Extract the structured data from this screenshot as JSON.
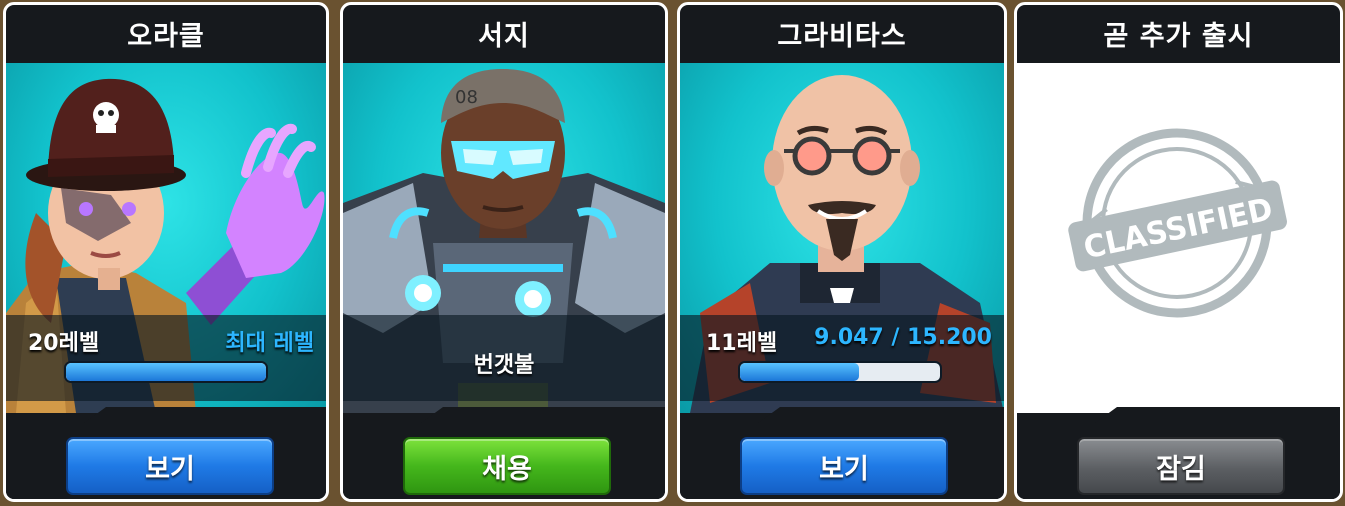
{
  "cards": [
    {
      "title": "오라클",
      "level_label": "20레벨",
      "level_status": "최대 레벨",
      "xp_fraction": 1.0,
      "button_label": "보기",
      "button_style": "blue"
    },
    {
      "title": "서지",
      "center_label": "번갯불",
      "button_label": "채용",
      "button_style": "green"
    },
    {
      "title": "그라비타스",
      "level_label": "11레벨",
      "xp_text": "9.047 / 15.200",
      "xp_fraction": 0.5952,
      "button_label": "보기",
      "button_style": "blue"
    },
    {
      "title": "곧 추가 출시",
      "stamp_text": "CLASSIFIED",
      "button_label": "잠김",
      "button_style": "grey"
    }
  ],
  "colors": {
    "accent_blue": "#2db6ff",
    "button_blue": "#1f7ae6",
    "button_green": "#45b71c",
    "button_grey": "#5c5f63",
    "portrait_bg": "#12c2cc",
    "card_bg": "#16191d"
  },
  "icons": {
    "oracle": "oracle-portrait",
    "surge": "surge-portrait",
    "gravitas": "gravitas-portrait",
    "stamp": "classified-stamp"
  }
}
